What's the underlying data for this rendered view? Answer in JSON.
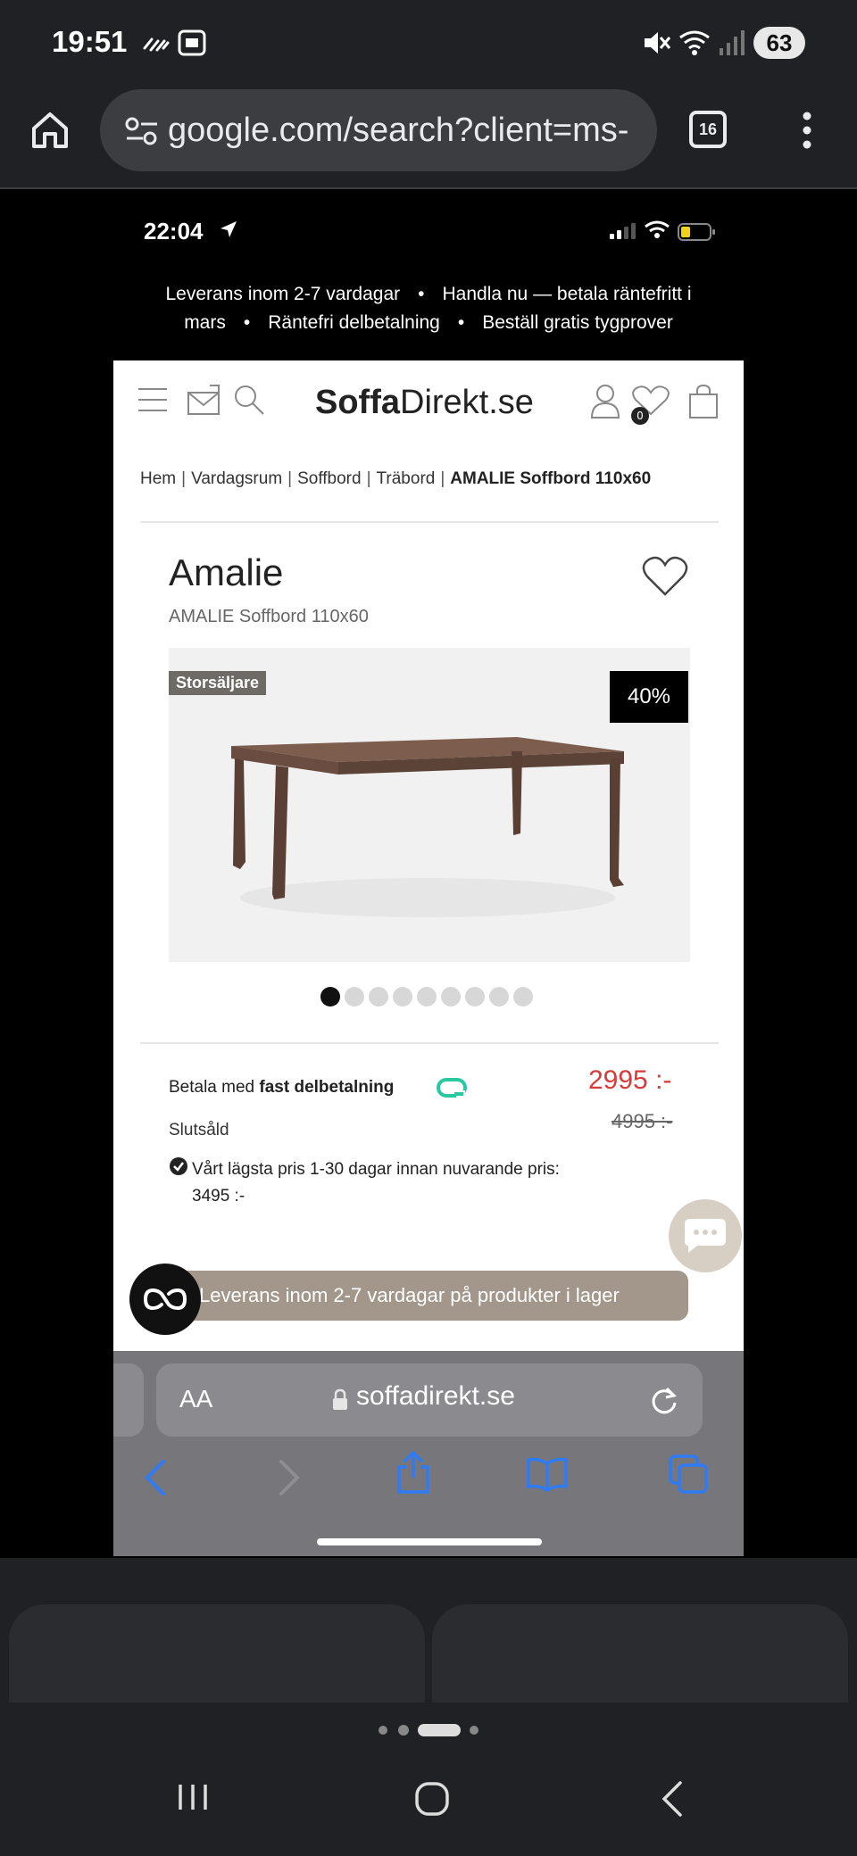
{
  "android_status": {
    "time": "19:51",
    "battery": "63",
    "icons": [
      "signal-stripes-icon",
      "screenshot-icon",
      "mute-icon",
      "wifi-icon",
      "cell-signal-icon"
    ]
  },
  "chrome": {
    "url": "google.com/search?client=ms-",
    "tab_count": "16",
    "icons": [
      "home-icon",
      "site-settings-icon",
      "more-menu-icon"
    ]
  },
  "ios_status": {
    "time": "22:04",
    "icons": [
      "location-arrow-icon",
      "cell-bars-icon",
      "wifi-icon",
      "battery-icon"
    ]
  },
  "announcement": {
    "items": [
      "Leverans inom 2-7 vardagar",
      "Handla nu — betala räntefritt i",
      "mars",
      "Räntefri delbetalning",
      "Beställ gratis tygprover"
    ]
  },
  "header": {
    "logo_bold": "Soffa",
    "logo_regular": "Direkt.se",
    "wishlist_count": "0"
  },
  "breadcrumb": {
    "items": [
      "Hem",
      "Vardagsrum",
      "Soffbord",
      "Träbord"
    ],
    "current": "AMALIE Soffbord 110x60",
    "separator": "|"
  },
  "product": {
    "title": "Amalie",
    "subtitle": "AMALIE Soffbord 110x60",
    "badge_best": "Storsäljare",
    "badge_discount": "40%",
    "carousel_count": 9,
    "carousel_active": 0
  },
  "pricing": {
    "pay_prefix": "Betala med",
    "pay_bold": "fast delbetalning",
    "price_now": "2995 :-",
    "price_old": "4995 :-",
    "stock": "Slutsåld",
    "lowest_price_line1": "Vårt lägsta pris 1-30 dagar innan nuvarande pris:",
    "lowest_price_line2": "3495 :-"
  },
  "delivery_banner": "Leverans inom 2-7 vardagar på produkter i lager",
  "safari": {
    "aa": "AA",
    "url": "soffadirekt.se"
  },
  "colors": {
    "sale_red": "#d83a3a",
    "banner_taupe": "#a3978b",
    "ios_link_blue": "#2f7bf5"
  }
}
